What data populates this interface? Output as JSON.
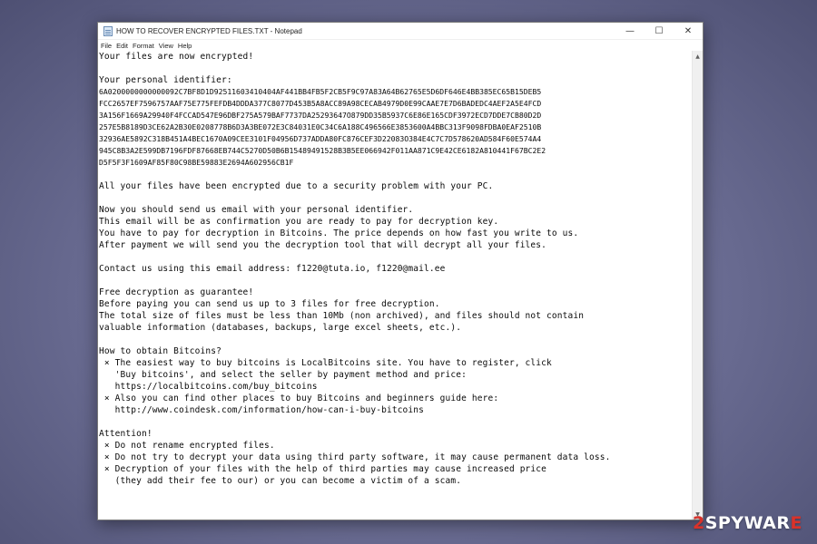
{
  "window": {
    "title": "HOW TO RECOVER ENCRYPTED FILES.TXT - Notepad",
    "icon": "notepad-icon",
    "controls": {
      "minimize": "—",
      "maximize": "☐",
      "close": "✕"
    }
  },
  "menu": [
    "File",
    "Edit",
    "Format",
    "View",
    "Help"
  ],
  "content": {
    "lines": [
      "Your files are now encrypted!",
      "",
      "Your personal identifier:",
      "6A0200000000000092C7BF8D1D92511603410404AF441BB4FB5F2CB5F9C97A83A64B62765E5D6DF646E4BB385EC65B15DEB5",
      "FCC2657EF7596757AAF75E775FEFDB4DDDA377C8077D453B5A8ACC89A98CECAB4979D0E99CAAE7E7D6BADEDC4AEF2A5E4FCD",
      "3A156F1669A29940F4FCCAD547E96DBF275A579BAF7737DA25293647O879DD35B5937C6E86E165CDF3972ECD7DDE7CB80D2D",
      "257E5B8189D3CE62A2B30E0208778B6D3A3BE072E3C84031E0C34C6A188C496566E3853600A4BBC313F9098FDBA0EAF2510B",
      "32936AE5892C318B451A4BEC1670A09CEE3101F04956D737ADDA80FC876CEF3D22083O384E4C7C7D578620AD584F60E574A4",
      "945C8B3A2E599DB7196FDF87668EB744C5270D50B6B15489491528B3B5EE066942F011AA871C9E42CE6182A810441F67BC2E2",
      "D5F5F3F1609AF85F80C98BE59883E2694A602956CB1F",
      "",
      "All your files have been encrypted due to a security problem with your PC.",
      "",
      "Now you should send us email with your personal identifier.",
      "This email will be as confirmation you are ready to pay for decryption key.",
      "You have to pay for decryption in Bitcoins. The price depends on how fast you write to us.",
      "After payment we will send you the decryption tool that will decrypt all your files.",
      "",
      "Contact us using this email address: f1220@tuta.io, f1220@mail.ee",
      "",
      "Free decryption as guarantee!",
      "Before paying you can send us up to 3 files for free decryption.",
      "The total size of files must be less than 10Mb (non archived), and files should not contain",
      "valuable information (databases, backups, large excel sheets, etc.).",
      "",
      "How to obtain Bitcoins?",
      " × The easiest way to buy bitcoins is LocalBitcoins site. You have to register, click",
      "   'Buy bitcoins', and select the seller by payment method and price:",
      "   https://localbitcoins.com/buy_bitcoins",
      " × Also you can find other places to buy Bitcoins and beginners guide here:",
      "   http://www.coindesk.com/information/how-can-i-buy-bitcoins",
      "",
      "Attention!",
      " × Do not rename encrypted files.",
      " × Do not try to decrypt your data using third party software, it may cause permanent data loss.",
      " × Decryption of your files with the help of third parties may cause increased price",
      "   (they add their fee to our) or you can become a victim of a scam."
    ]
  },
  "watermark": {
    "part1": "2",
    "part2": "SPYWAR",
    "part3": "E"
  }
}
